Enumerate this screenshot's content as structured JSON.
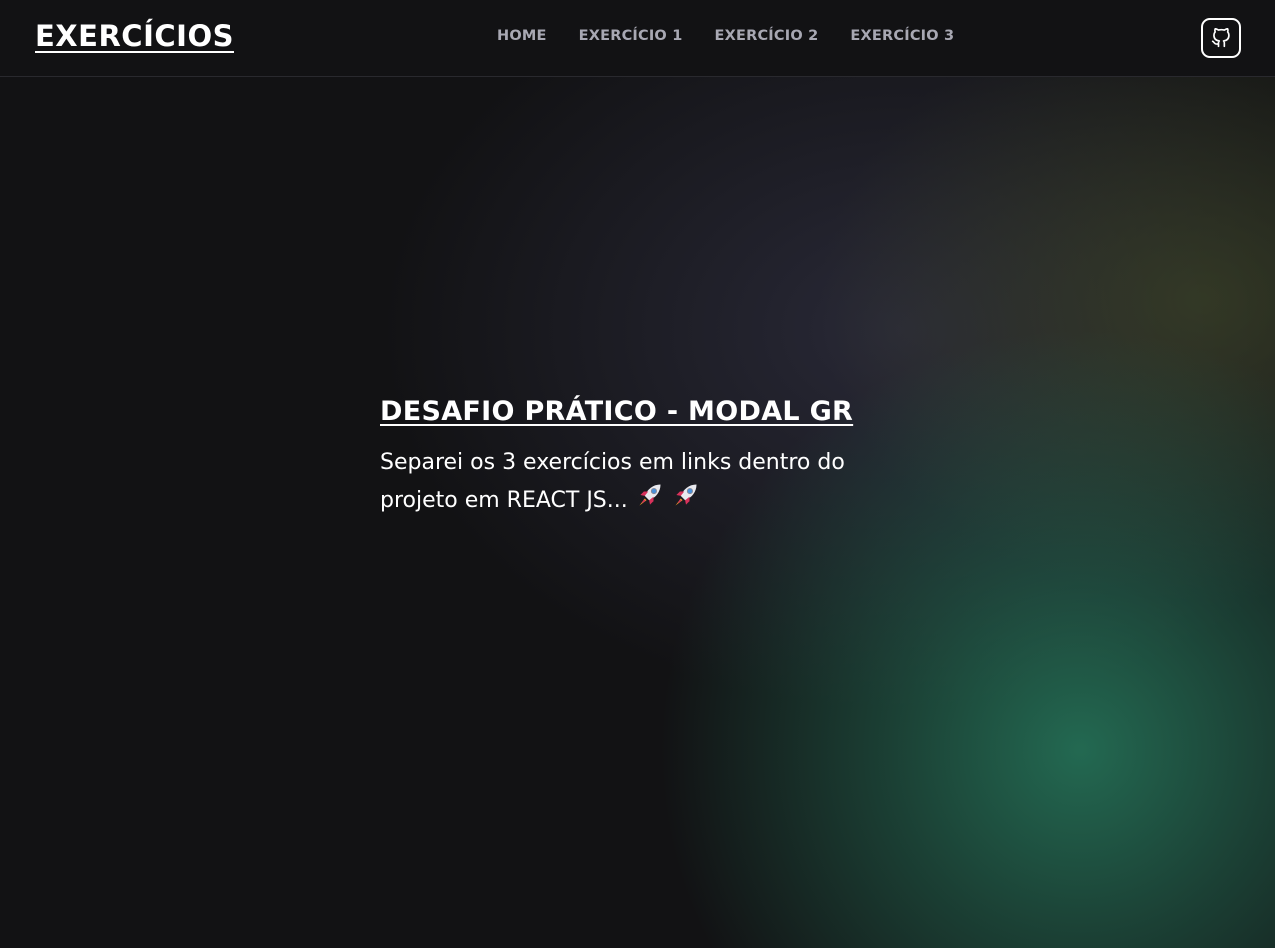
{
  "header": {
    "logo": "EXERCÍCIOS",
    "nav": [
      {
        "label": "HOME"
      },
      {
        "label": "EXERCÍCIO 1"
      },
      {
        "label": "EXERCÍCIO 2"
      },
      {
        "label": "EXERCÍCIO 3"
      }
    ],
    "github_icon": "github-icon"
  },
  "hero": {
    "title": "DESAFIO PRÁTICO - MODAL GR",
    "text": "Separei os 3 exercícios em links dentro do projeto em REACT JS...",
    "emoji_icon": "rocket-icon"
  },
  "colors": {
    "background": "#121214",
    "nav_text": "#a8a8b3",
    "text": "#ffffff",
    "glow_green": "#26785c"
  }
}
